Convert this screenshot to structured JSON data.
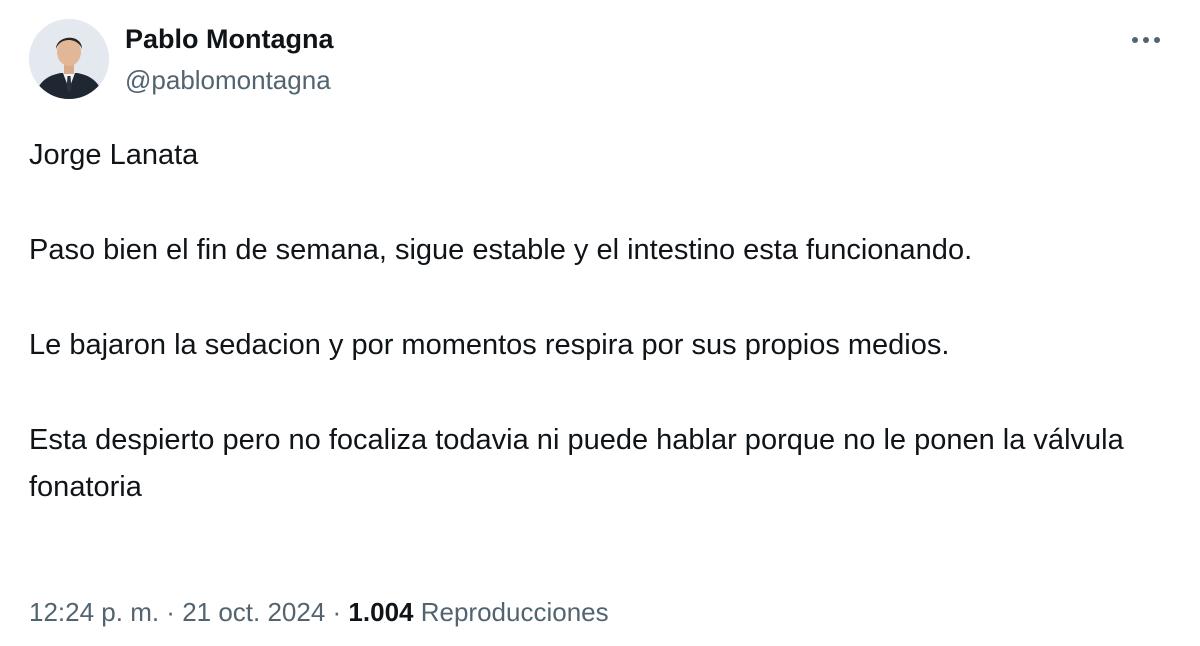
{
  "author": {
    "display_name": "Pablo Montagna",
    "handle": "@pablomontagna"
  },
  "more_icon": "more-horizontal-icon",
  "tweet": {
    "paragraphs": [
      "Jorge Lanata",
      "Paso bien el fin de semana, sigue estable y el intestino esta funcionando.",
      "Le bajaron la sedacion y por momentos respira por sus propios medios.",
      "Esta despierto pero no focaliza todavia ni puede hablar porque no le ponen la válvula fonatoria"
    ]
  },
  "meta": {
    "time": "12:24 p. m.",
    "separator": " · ",
    "date": "21 oct. 2024",
    "views_count": "1.004",
    "views_label": "Reproducciones"
  },
  "colors": {
    "text_primary": "#0f1419",
    "text_secondary": "#536471",
    "background": "#ffffff"
  }
}
